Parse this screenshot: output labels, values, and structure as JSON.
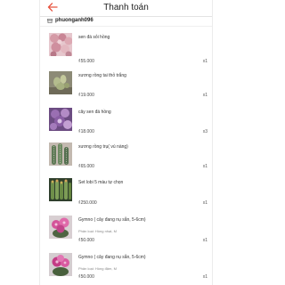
{
  "header": {
    "title": "Thanh toán",
    "back_icon": "arrow-left-icon",
    "accent": "#e8533f"
  },
  "shop": {
    "name": "phuonganh096",
    "icon": "store-icon"
  },
  "items": [
    {
      "name": "sen đá sỏi hồng",
      "variant": "",
      "price": "₫55.000",
      "qty": "x1"
    },
    {
      "name": "xương rồng tai thỏ trắng",
      "variant": "",
      "price": "₫19.000",
      "qty": "x1"
    },
    {
      "name": "cây sen đá hồng",
      "variant": "",
      "price": "₫18.000",
      "qty": "x3"
    },
    {
      "name": "xương rồng trụ( vú nàng)",
      "variant": "",
      "price": "₫65.000",
      "qty": "x1"
    },
    {
      "name": "Set lobi 5 màu tự chọn",
      "variant": "",
      "price": "₫250.000",
      "qty": "x1"
    },
    {
      "name": "Gymno ( cây đang nụ sẵn, 5-6cm)",
      "variant": "Phân loại: Hồng nhạt, M",
      "price": "₫50.000",
      "qty": "x1"
    },
    {
      "name": "Gymno ( cây đang nụ sẵn, 5-6cm)",
      "variant": "Phân loại: Hồng đậm, M",
      "price": "₫50.000",
      "qty": "x1"
    }
  ]
}
